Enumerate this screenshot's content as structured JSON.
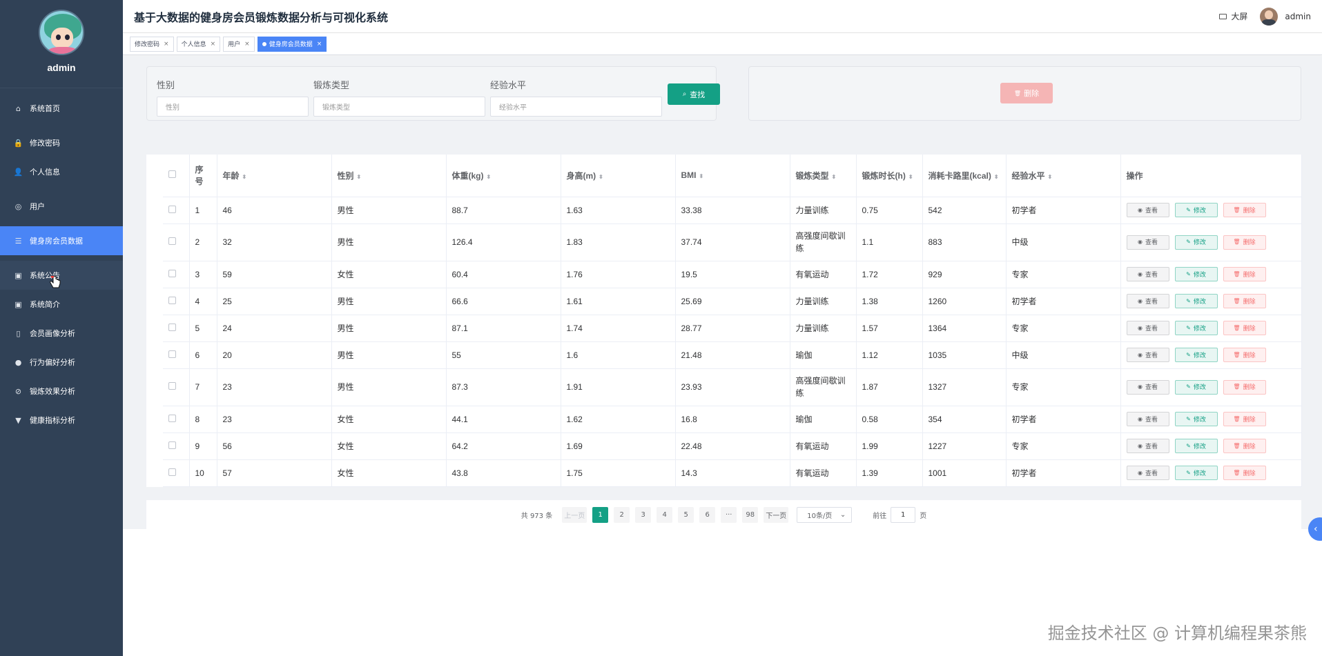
{
  "sidebar": {
    "username": "admin",
    "items": [
      {
        "label": "系统首页",
        "icon": "home-icon",
        "glyph": "⌂"
      },
      {
        "label": "修改密码",
        "icon": "lock-icon",
        "glyph": "🔒"
      },
      {
        "label": "个人信息",
        "icon": "user-icon",
        "glyph": "👤"
      },
      {
        "label": "用户",
        "icon": "globe-icon",
        "glyph": "◎"
      },
      {
        "label": "健身房会员数据",
        "icon": "sliders-icon",
        "glyph": "☰"
      },
      {
        "label": "系统公告",
        "icon": "clipboard-icon",
        "glyph": "▣"
      },
      {
        "label": "系统简介",
        "icon": "clipboard-icon",
        "glyph": "▣"
      },
      {
        "label": "会员画像分析",
        "icon": "phone-icon",
        "glyph": "▯"
      },
      {
        "label": "行为偏好分析",
        "icon": "location-icon",
        "glyph": "●"
      },
      {
        "label": "锻炼效果分析",
        "icon": "bell-off-icon",
        "glyph": "⊘"
      },
      {
        "label": "健康指标分析",
        "icon": "flag-icon",
        "glyph": "▼"
      }
    ]
  },
  "header": {
    "title": "基于大数据的健身房会员锻炼数据分析与可视化系统",
    "bigscreen_label": "大屏",
    "user_name": "admin"
  },
  "tags": [
    {
      "label": "修改密码"
    },
    {
      "label": "个人信息"
    },
    {
      "label": "用户"
    },
    {
      "label": "健身房会员数据"
    }
  ],
  "search": {
    "fields": [
      {
        "label": "性别",
        "placeholder": "性别"
      },
      {
        "label": "锻炼类型",
        "placeholder": "锻炼类型"
      },
      {
        "label": "经验水平",
        "placeholder": "经验水平"
      }
    ],
    "search_button": "查找",
    "delete_button": "删除"
  },
  "table": {
    "headers": [
      "序号",
      "年龄",
      "性别",
      "体重(kg)",
      "身高(m)",
      "BMI",
      "锻炼类型",
      "锻炼时长(h)",
      "消耗卡路里(kcal)",
      "经验水平",
      "操作"
    ],
    "ops": {
      "view": "查看",
      "edit": "修改",
      "delete": "删除"
    },
    "rows": [
      [
        "1",
        "46",
        "男性",
        "88.7",
        "1.63",
        "33.38",
        "力量训练",
        "0.75",
        "542",
        "初学者"
      ],
      [
        "2",
        "32",
        "男性",
        "126.4",
        "1.83",
        "37.74",
        "高强度间歇训练",
        "1.1",
        "883",
        "中级"
      ],
      [
        "3",
        "59",
        "女性",
        "60.4",
        "1.76",
        "19.5",
        "有氧运动",
        "1.72",
        "929",
        "专家"
      ],
      [
        "4",
        "25",
        "男性",
        "66.6",
        "1.61",
        "25.69",
        "力量训练",
        "1.38",
        "1260",
        "初学者"
      ],
      [
        "5",
        "24",
        "男性",
        "87.1",
        "1.74",
        "28.77",
        "力量训练",
        "1.57",
        "1364",
        "专家"
      ],
      [
        "6",
        "20",
        "男性",
        "55",
        "1.6",
        "21.48",
        "瑜伽",
        "1.12",
        "1035",
        "中级"
      ],
      [
        "7",
        "23",
        "男性",
        "87.3",
        "1.91",
        "23.93",
        "高强度间歇训练",
        "1.87",
        "1327",
        "专家"
      ],
      [
        "8",
        "23",
        "女性",
        "44.1",
        "1.62",
        "16.8",
        "瑜伽",
        "0.58",
        "354",
        "初学者"
      ],
      [
        "9",
        "56",
        "女性",
        "64.2",
        "1.69",
        "22.48",
        "有氧运动",
        "1.99",
        "1227",
        "专家"
      ],
      [
        "10",
        "57",
        "女性",
        "43.8",
        "1.75",
        "14.3",
        "有氧运动",
        "1.39",
        "1001",
        "初学者"
      ]
    ]
  },
  "pagination": {
    "total": "共 973 条",
    "prev": "上一页",
    "next": "下一页",
    "pages": [
      "1",
      "2",
      "3",
      "4",
      "5",
      "6",
      "···",
      "98"
    ],
    "page_size": "10条/页",
    "goto_label": "前往",
    "goto_value": "1",
    "goto_suffix": "页"
  },
  "watermark": "掘金技术社区 @ 计算机编程果茶熊"
}
